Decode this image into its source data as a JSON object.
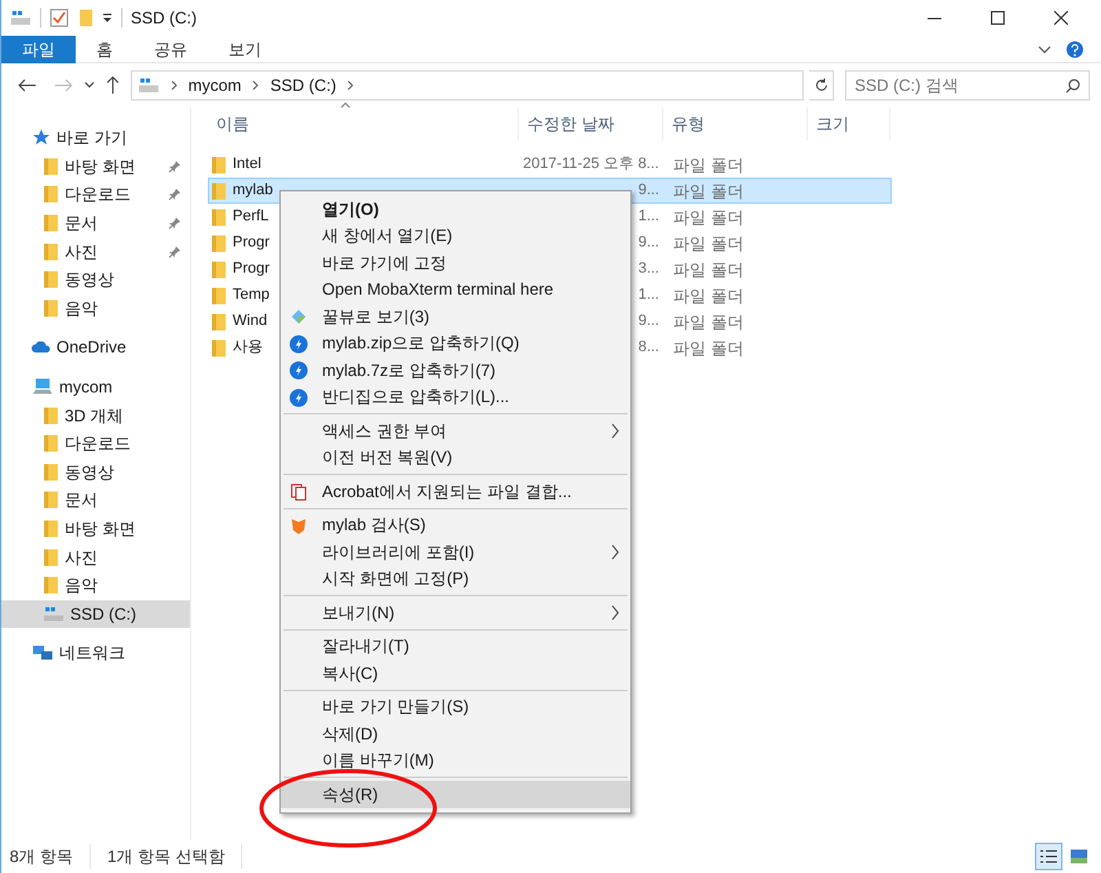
{
  "window": {
    "title": "SSD (C:)"
  },
  "ribbon_tabs": [
    {
      "label": "파일",
      "selected": true
    },
    {
      "label": "홈",
      "selected": false
    },
    {
      "label": "공유",
      "selected": false
    },
    {
      "label": "보기",
      "selected": false
    }
  ],
  "address": {
    "crumbs": [
      "mycom",
      "SSD (C:)"
    ]
  },
  "search": {
    "placeholder": "SSD (C:) 검색"
  },
  "sidebar": {
    "items": [
      {
        "label": "바로 가기",
        "kind": "star",
        "selected": false,
        "children": [
          {
            "label": "바탕 화면",
            "kind": "folder",
            "pinned": true,
            "selected": false
          },
          {
            "label": "다운로드",
            "kind": "folder",
            "pinned": true,
            "selected": false
          },
          {
            "label": "문서",
            "kind": "folder",
            "pinned": true,
            "selected": false
          },
          {
            "label": "사진",
            "kind": "folder",
            "pinned": true,
            "selected": false
          },
          {
            "label": "동영상",
            "kind": "folder",
            "pinned": false,
            "selected": false
          },
          {
            "label": "음악",
            "kind": "folder",
            "pinned": false,
            "selected": false
          }
        ]
      },
      {
        "label": "OneDrive",
        "kind": "cloud",
        "selected": false
      },
      {
        "label": "mycom",
        "kind": "pc",
        "selected": false,
        "children": [
          {
            "label": "3D 개체",
            "kind": "folder",
            "pinned": false,
            "selected": false
          },
          {
            "label": "다운로드",
            "kind": "folder",
            "pinned": false,
            "selected": false
          },
          {
            "label": "동영상",
            "kind": "folder",
            "pinned": false,
            "selected": false
          },
          {
            "label": "문서",
            "kind": "folder",
            "pinned": false,
            "selected": false
          },
          {
            "label": "바탕 화면",
            "kind": "folder",
            "pinned": false,
            "selected": false
          },
          {
            "label": "사진",
            "kind": "folder",
            "pinned": false,
            "selected": false
          },
          {
            "label": "음악",
            "kind": "folder",
            "pinned": false,
            "selected": false
          },
          {
            "label": "SSD (C:)",
            "kind": "drive",
            "selected": true
          }
        ]
      },
      {
        "label": "네트워크",
        "kind": "network",
        "selected": false
      }
    ]
  },
  "table": {
    "columns": [
      "이름",
      "수정한 날짜",
      "유형",
      "크기"
    ],
    "rows": [
      {
        "name": "Intel",
        "date": "2017-11-25 오후 8...",
        "type": "파일 폴더",
        "selected": false
      },
      {
        "name": "mylab",
        "date": "9...",
        "type": "파일 폴더",
        "selected": true
      },
      {
        "name": "PerfL",
        "date": "1...",
        "type": "파일 폴더",
        "selected": false
      },
      {
        "name": "Progr",
        "date": "9...",
        "type": "파일 폴더",
        "selected": false
      },
      {
        "name": "Progr",
        "date": "3...",
        "type": "파일 폴더",
        "selected": false
      },
      {
        "name": "Temp",
        "date": "1...",
        "type": "파일 폴더",
        "selected": false
      },
      {
        "name": "Wind",
        "date": "9...",
        "type": "파일 폴더",
        "selected": false
      },
      {
        "name": "사용",
        "date": "8...",
        "type": "파일 폴더",
        "selected": false
      }
    ]
  },
  "context_menu": {
    "items": [
      {
        "kind": "plain",
        "label": "열기(O)",
        "bold": true,
        "submenu": false,
        "selected": false
      },
      {
        "kind": "plain",
        "label": "새 창에서 열기(E)",
        "bold": false,
        "submenu": false,
        "selected": false
      },
      {
        "kind": "plain",
        "label": "바로 가기에 고정",
        "bold": false,
        "submenu": false,
        "selected": false
      },
      {
        "kind": "plain",
        "label": "Open MobaXterm terminal here",
        "bold": false,
        "submenu": false,
        "selected": false
      },
      {
        "kind": "viewer",
        "label": "꿀뷰로 보기(3)",
        "bold": false,
        "submenu": false,
        "selected": false
      },
      {
        "kind": "archiver",
        "label": "mylab.zip으로 압축하기(Q)",
        "bold": false,
        "submenu": false,
        "selected": false
      },
      {
        "kind": "archiver",
        "label": "mylab.7z로 압축하기(7)",
        "bold": false,
        "submenu": false,
        "selected": false
      },
      {
        "kind": "archiver",
        "label": "반디집으로 압축하기(L)...",
        "bold": false,
        "submenu": false,
        "selected": false
      },
      {
        "kind": "separator"
      },
      {
        "kind": "plain",
        "label": "액세스 권한 부여",
        "bold": false,
        "submenu": true,
        "selected": false
      },
      {
        "kind": "plain",
        "label": "이전 버전 복원(V)",
        "bold": false,
        "submenu": false,
        "selected": false
      },
      {
        "kind": "separator"
      },
      {
        "kind": "pdf",
        "label": "Acrobat에서 지원되는 파일 결합...",
        "bold": false,
        "submenu": false,
        "selected": false
      },
      {
        "kind": "separator"
      },
      {
        "kind": "antivirus",
        "label": "mylab 검사(S)",
        "bold": false,
        "submenu": false,
        "selected": false
      },
      {
        "kind": "plain",
        "label": "라이브러리에 포함(I)",
        "bold": false,
        "submenu": true,
        "selected": false
      },
      {
        "kind": "plain",
        "label": "시작 화면에 고정(P)",
        "bold": false,
        "submenu": false,
        "selected": false
      },
      {
        "kind": "separator"
      },
      {
        "kind": "plain",
        "label": "보내기(N)",
        "bold": false,
        "submenu": true,
        "selected": false
      },
      {
        "kind": "separator"
      },
      {
        "kind": "plain",
        "label": "잘라내기(T)",
        "bold": false,
        "submenu": false,
        "selected": false
      },
      {
        "kind": "plain",
        "label": "복사(C)",
        "bold": false,
        "submenu": false,
        "selected": false
      },
      {
        "kind": "separator"
      },
      {
        "kind": "plain",
        "label": "바로 가기 만들기(S)",
        "bold": false,
        "submenu": false,
        "selected": false
      },
      {
        "kind": "plain",
        "label": "삭제(D)",
        "bold": false,
        "submenu": false,
        "selected": false
      },
      {
        "kind": "plain",
        "label": "이름 바꾸기(M)",
        "bold": false,
        "submenu": false,
        "selected": false
      },
      {
        "kind": "separator"
      },
      {
        "kind": "plain",
        "label": "속성(R)",
        "bold": false,
        "submenu": false,
        "selected": true
      }
    ]
  },
  "callout": {
    "kind": "ellipse"
  },
  "status_bar": {
    "item_count": "8개 항목",
    "selection": "1개 항목 선택함"
  }
}
